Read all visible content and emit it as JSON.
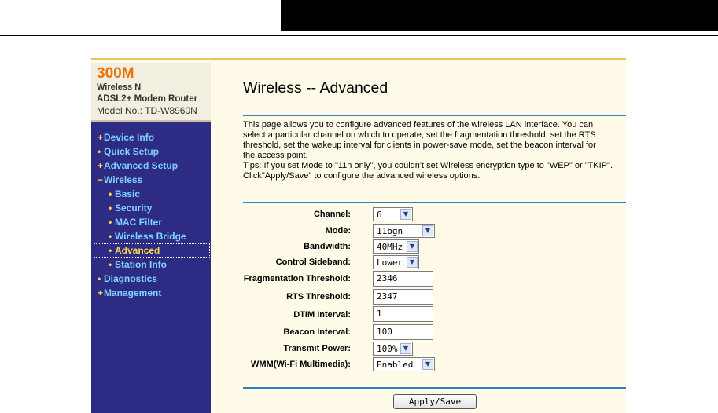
{
  "logo": {
    "brand": "300M",
    "line1": "Wireless N",
    "line2": "ADSL2+ Modem Router",
    "model": "Model No.: TD-W8960N"
  },
  "nav": [
    {
      "marker": "+",
      "label": "Device Info",
      "level": 0
    },
    {
      "marker": "•",
      "label": "Quick Setup",
      "level": 0
    },
    {
      "marker": "+",
      "label": "Advanced Setup",
      "level": 0
    },
    {
      "marker": "−",
      "label": "Wireless",
      "level": 0
    },
    {
      "marker": "•",
      "label": "Basic",
      "level": 1
    },
    {
      "marker": "•",
      "label": "Security",
      "level": 1
    },
    {
      "marker": "•",
      "label": "MAC Filter",
      "level": 1
    },
    {
      "marker": "•",
      "label": "Wireless Bridge",
      "level": 1
    },
    {
      "marker": "•",
      "label": "Advanced",
      "level": 1,
      "active": true
    },
    {
      "marker": "•",
      "label": "Station Info",
      "level": 1
    },
    {
      "marker": "•",
      "label": "Diagnostics",
      "level": 0
    },
    {
      "marker": "+",
      "label": "Management",
      "level": 0
    }
  ],
  "page": {
    "title": "Wireless -- Advanced",
    "desc_lines": [
      "This page allows you to configure advanced features of the wireless LAN interface. You can",
      "select a particular channel on which to operate, set the fragmentation threshold, set the RTS",
      "threshold, set the wakeup interval for clients in power-save mode, set the beacon interval for",
      "the access point.",
      "Tips: If you set Mode to \"11n only\", you couldn't set Wireless encryption type to \"WEP\" or \"TKIP\".",
      "Click\"Apply/Save\" to configure the advanced wireless options."
    ]
  },
  "form": {
    "channel": {
      "label": "Channel:",
      "value": "6"
    },
    "mode": {
      "label": "Mode:",
      "value": "11bgn"
    },
    "bandwidth": {
      "label": "Bandwidth:",
      "value": "40MHz"
    },
    "sideband": {
      "label": "Control Sideband:",
      "value": "Lower"
    },
    "frag": {
      "label": "Fragmentation Threshold:",
      "value": "2346"
    },
    "rts": {
      "label": "RTS Threshold:",
      "value": "2347"
    },
    "dtim": {
      "label": "DTIM Interval:",
      "value": "1"
    },
    "beacon": {
      "label": "Beacon Interval:",
      "value": "100"
    },
    "power": {
      "label": "Transmit Power:",
      "value": "100%"
    },
    "wmm": {
      "label": "WMM(Wi-Fi Multimedia):",
      "value": "Enabled"
    }
  },
  "apply_label": "Apply/Save",
  "colors": {
    "sidebar": "#2d2b84",
    "accent": "#2f82c4",
    "brand": "#e8740a"
  }
}
